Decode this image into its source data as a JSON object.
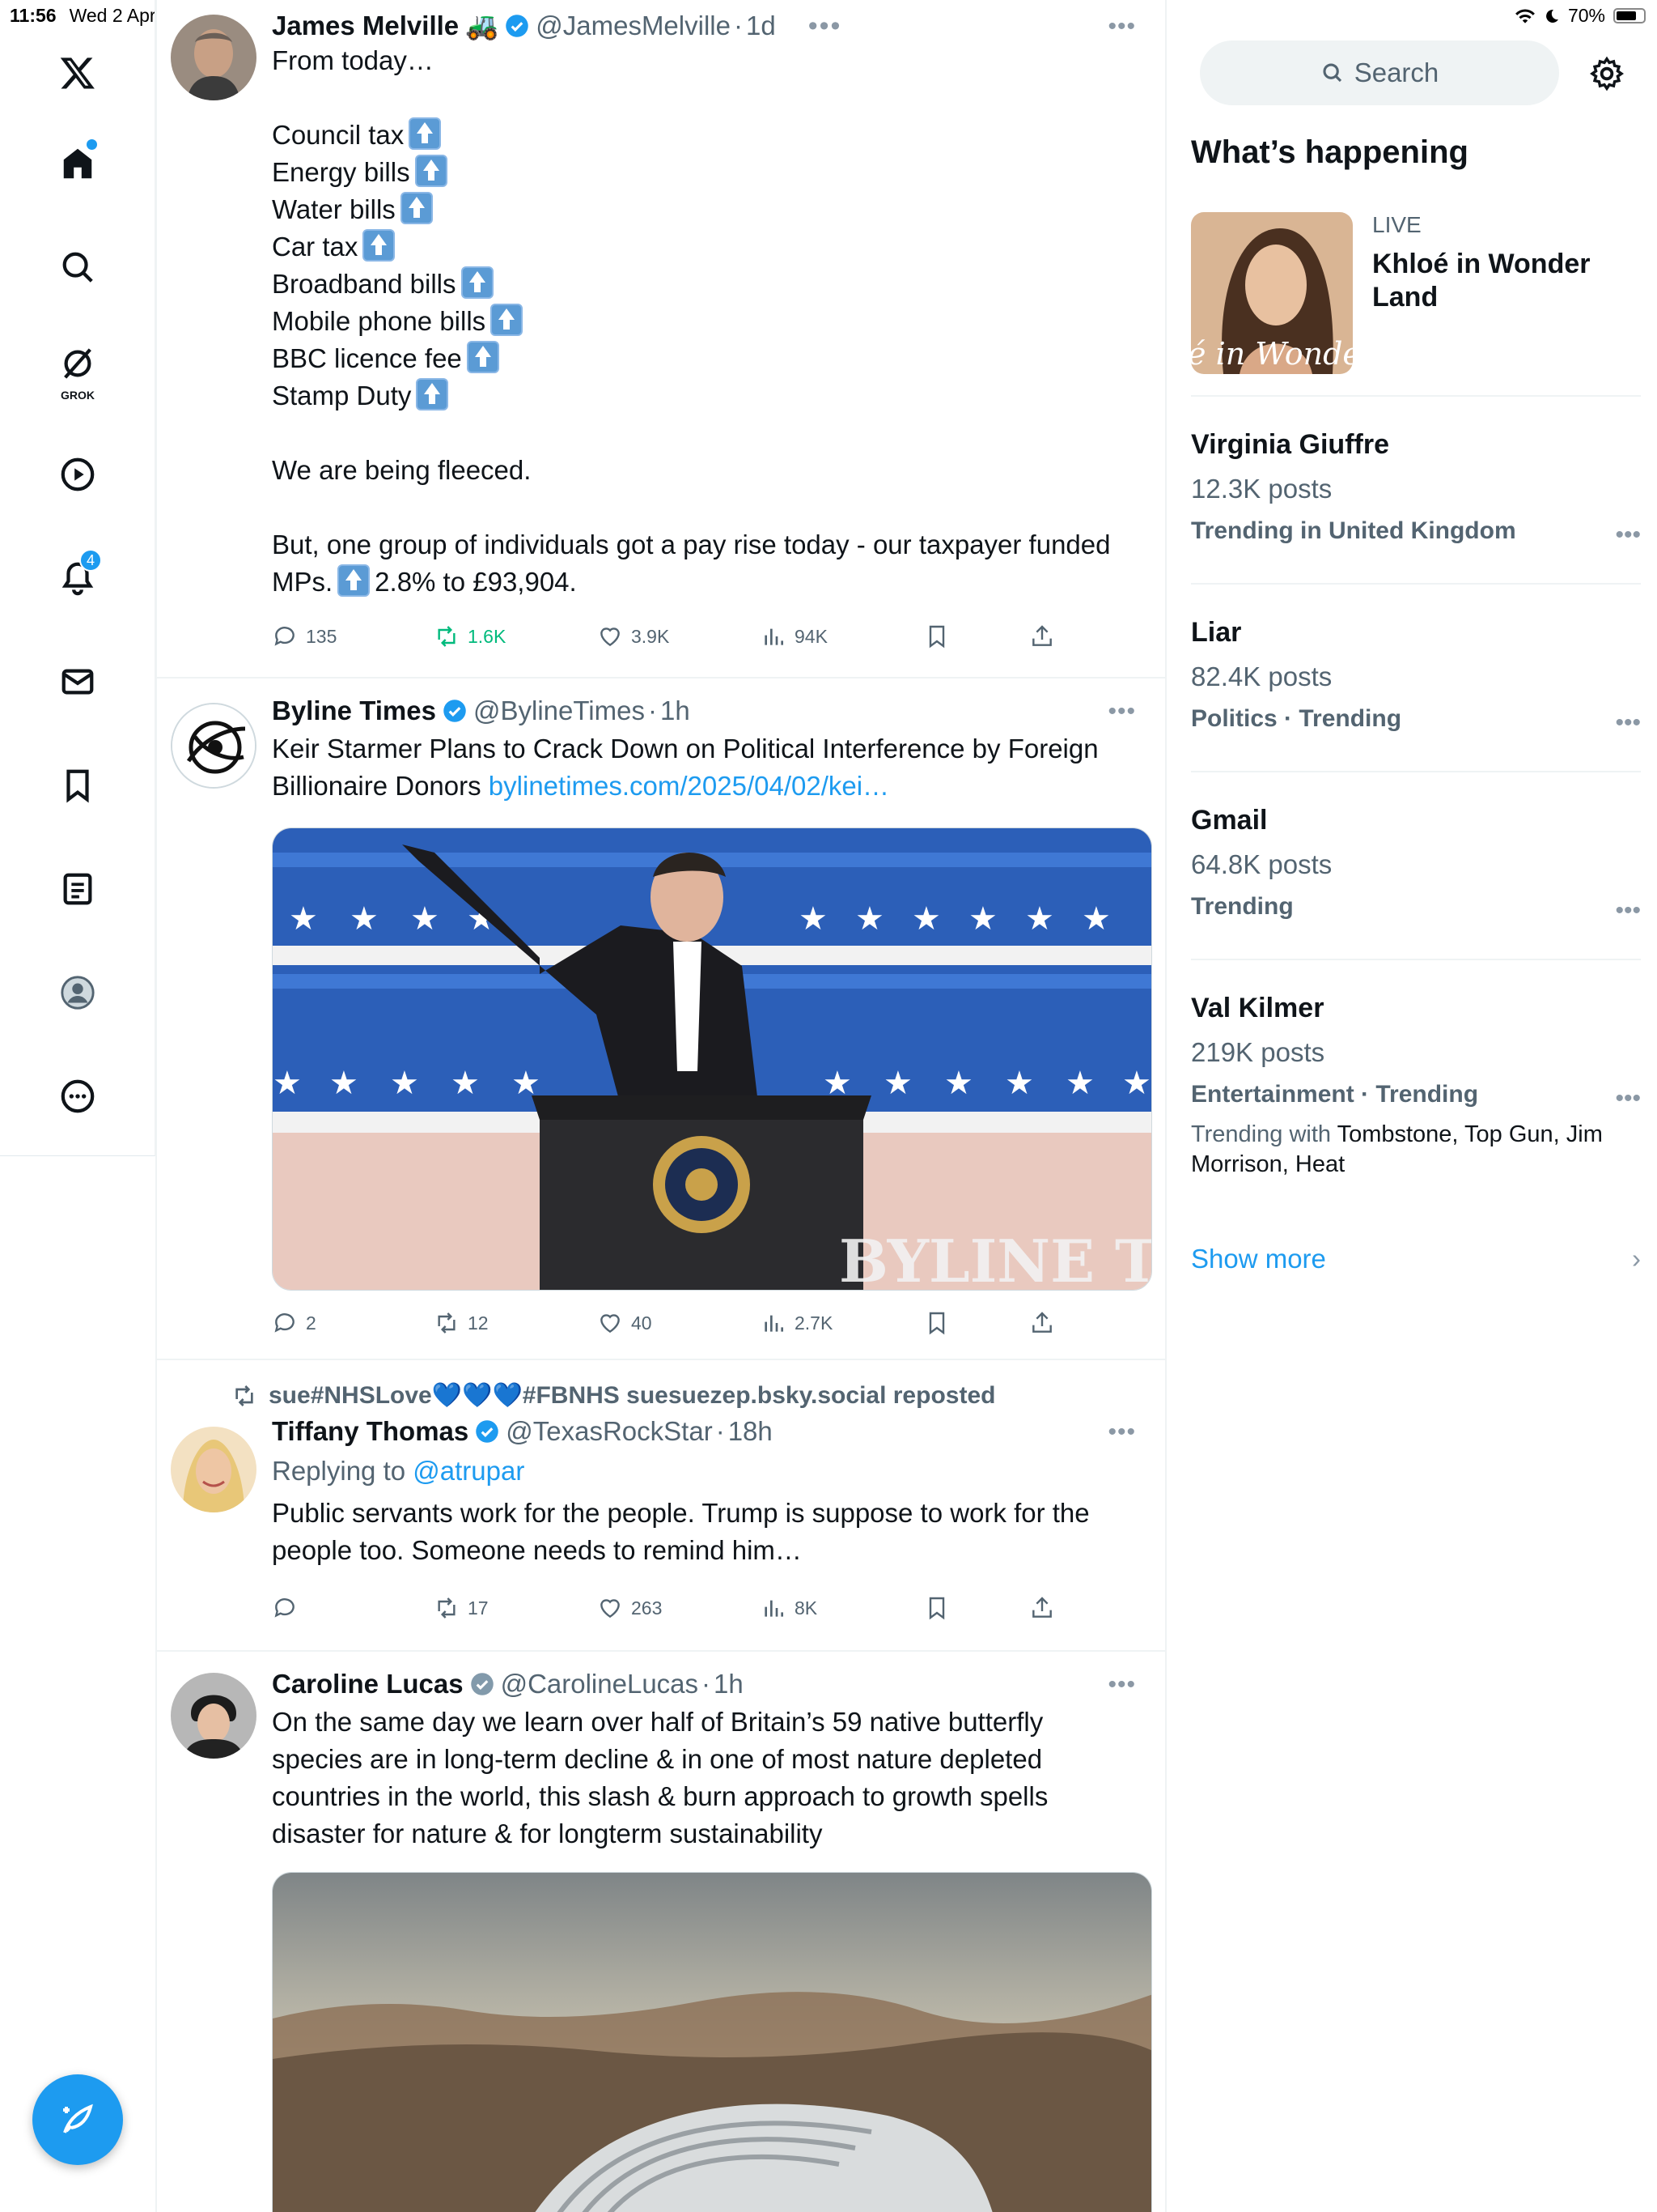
{
  "status_bar": {
    "time": "11:56",
    "date": "Wed 2 Apr",
    "battery": "70%",
    "battery_level": 0.7
  },
  "nav": {
    "grok_label": "GROK",
    "notifications_badge": "4"
  },
  "tweets": [
    {
      "name": "James Melville",
      "emoji": "🚜",
      "handle": "@JamesMelville",
      "dot": "·",
      "time": "1d",
      "text_intro": "From today…",
      "bills": [
        "Council tax",
        "Energy bills",
        "Water bills",
        "Car tax",
        "Broadband bills",
        "Mobile phone bills",
        "BBC licence fee",
        "Stamp Duty"
      ],
      "text_fleeced": "We are being fleeced.",
      "text_pay_1": "But, one group of individuals got a pay rise today - our taxpayer funded",
      "text_pay_2a": "MPs.",
      "text_pay_2b": "2.8% to £93,904.",
      "replies": "135",
      "reposts": "1.6K",
      "likes": "3.9K",
      "views": "94K"
    },
    {
      "name": "Byline Times",
      "handle": "@BylineTimes",
      "dot": "·",
      "time": "1h",
      "text_1": "Keir Starmer Plans to Crack Down on Political Interference by Foreign",
      "text_2": "Billionaire Donors",
      "link": "bylinetimes.com/2025/04/02/kei…",
      "media_watermark": "BYLINE TIMES",
      "replies": "2",
      "reposts": "12",
      "likes": "40",
      "views": "2.7K"
    },
    {
      "repost_by": "sue#NHSLove💙💙💙#FBNHS suesuezep.bsky.social reposted",
      "name": "Tiffany Thomas",
      "handle": "@TexasRockStar",
      "dot": "·",
      "time": "18h",
      "replying_label": "Replying to",
      "replying_handle": "@atrupar",
      "text_1": "Public servants work for the people. Trump is suppose to work for the",
      "text_2": "people too. Someone needs to remind him…",
      "replies": "",
      "reposts": "17",
      "likes": "263",
      "views": "8K"
    },
    {
      "name": "Caroline Lucas",
      "handle": "@CarolineLucas",
      "dot": "·",
      "time": "1h",
      "text_1": "On the same day we learn over half of Britain’s 59 native butterfly",
      "text_2": "species are in long-term decline & in one of most nature depleted",
      "text_3": "countries in the world, this slash & burn approach to growth spells",
      "text_4": "disaster for nature & for longterm sustainability"
    }
  ],
  "sidebar": {
    "search_placeholder": "Search",
    "title": "What’s happening",
    "live": {
      "label": "LIVE",
      "title": "Khloé in Wonder Land",
      "image_text": "é in Wonder L"
    },
    "trends": [
      {
        "name": "Virginia Giuffre",
        "count": "12.3K posts",
        "meta": "Trending in United Kingdom"
      },
      {
        "name": "Liar",
        "count": "82.4K posts",
        "meta": "Politics · Trending"
      },
      {
        "name": "Gmail",
        "count": "64.8K posts",
        "meta": "Trending"
      },
      {
        "name": "Val Kilmer",
        "count": "219K posts",
        "meta": "Entertainment · Trending",
        "with_label": "Trending with",
        "with_names": "Tombstone, Top Gun, Jim Morrison, Heat"
      }
    ],
    "show_more": "Show more"
  },
  "colors": {
    "accent": "#1d9bf0",
    "repost_green": "#00ba7c",
    "text": "#0f1419",
    "muted": "#536471"
  }
}
